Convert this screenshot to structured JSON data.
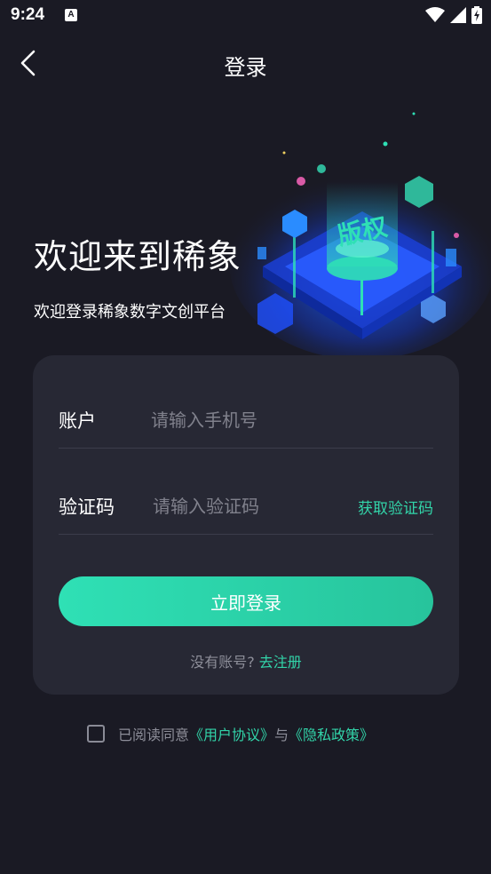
{
  "status_bar": {
    "time": "9:24",
    "notification_icon": "A",
    "icons": [
      "wifi-icon",
      "signal-icon",
      "battery-charging-icon"
    ]
  },
  "nav": {
    "title": "登录",
    "back_icon": "chevron-left-icon"
  },
  "hero": {
    "title": "欢迎来到稀象",
    "subtitle": "欢迎登录稀象数字文创平台",
    "art_label": "版权"
  },
  "form": {
    "account_label": "账户",
    "account_placeholder": "请输入手机号",
    "account_value": "",
    "code_label": "验证码",
    "code_placeholder": "请输入验证码",
    "code_value": "",
    "get_code_label": "获取验证码",
    "login_button": "立即登录",
    "no_account_text": "没有账号?",
    "register_link": "去注册"
  },
  "agreement": {
    "checked": false,
    "prefix": "已阅读同意",
    "user_agreement": "《用户协议》",
    "conjunction": "与",
    "privacy_policy": "《隐私政策》"
  },
  "colors": {
    "background": "#1a1a24",
    "card": "#272834",
    "accent": "#32d4a9",
    "muted_text": "#8d8e99"
  }
}
